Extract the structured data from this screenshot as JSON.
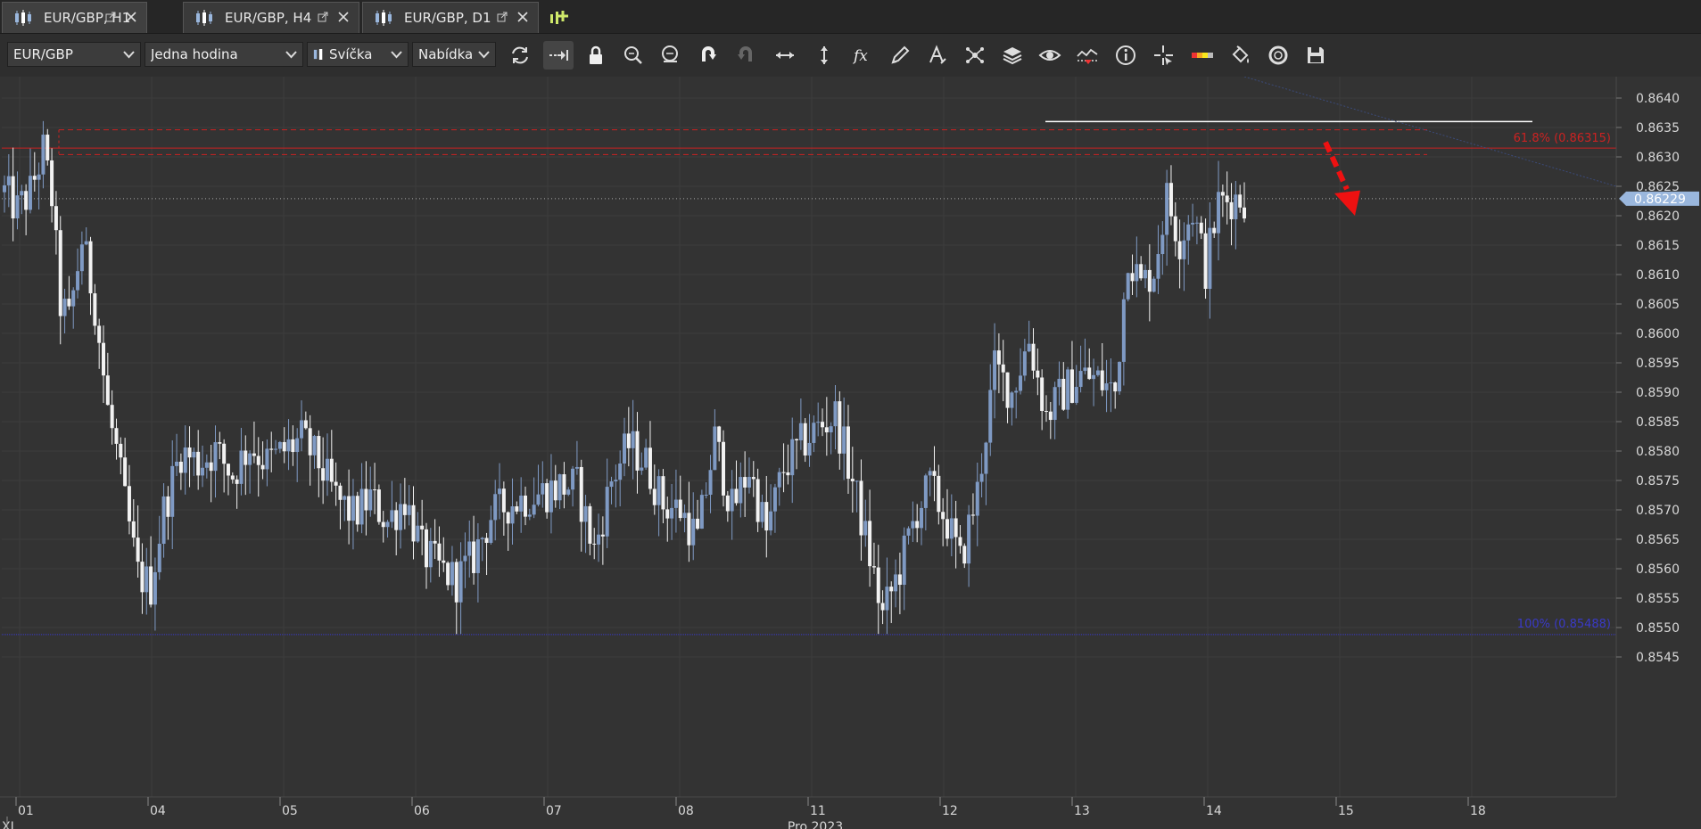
{
  "tabs": [
    {
      "label": "EUR/GBP, H1",
      "active": true
    },
    {
      "label": "EUR/GBP, H4",
      "active": false
    },
    {
      "label": "EUR/GBP, D1",
      "active": false
    }
  ],
  "toolbar": {
    "symbol": "EUR/GBP",
    "timeframe": "Jedna hodina",
    "chart_type": "Svíčka",
    "price_type": "Nabídka",
    "tools": [
      "refresh-icon",
      "auto-scroll-icon",
      "lock-icon",
      "zoom-in-icon",
      "zoom-out-icon",
      "undo-icon",
      "redo-icon",
      "horizontal-resize-icon",
      "vertical-resize-icon",
      "function-icon",
      "pencil-icon",
      "text-tool-icon",
      "objects-icon",
      "layers-icon",
      "eye-icon",
      "alerts-icon",
      "info-icon",
      "crosshair-icon",
      "color-scheme-icon",
      "paint-bucket-icon",
      "sync-icon",
      "save-icon"
    ]
  },
  "colors": {
    "background": "#333333",
    "grid": "#3d3d3d",
    "bull": "#7f9ac4",
    "bear": "#f2f2f2",
    "fib_upper": "#cc2222",
    "fib_lower": "#3a3ac8",
    "price_label": "#9ab7dd",
    "arrow": "#ee1111"
  },
  "chart_data": {
    "type": "candlestick",
    "symbol": "EUR/GBP",
    "timeframe": "H1",
    "ylim": [
      0.854,
      0.8643
    ],
    "y_ticks": [
      "0.8640",
      "0.8635",
      "0.8630",
      "0.8625",
      "0.8620",
      "0.8615",
      "0.8610",
      "0.8605",
      "0.8600",
      "0.8595",
      "0.8590",
      "0.8585",
      "0.8580",
      "0.8575",
      "0.8570",
      "0.8565",
      "0.8560",
      "0.8555",
      "0.8550",
      "0.8545"
    ],
    "x_ticks": [
      "01",
      "04",
      "05",
      "06",
      "07",
      "08",
      "11",
      "12",
      "13",
      "14",
      "15",
      "18"
    ],
    "x_month_labels": [
      "XI",
      "Pro 2023"
    ],
    "current_price": "0.86229",
    "fib_levels": [
      {
        "label": "61.8% (0.86315)",
        "value": 0.86315
      },
      {
        "label": "100% (0.85488)",
        "value": 0.85488
      }
    ],
    "anchors": [
      {
        "i": 0,
        "v": 0.8624
      },
      {
        "i": 3,
        "v": 0.8621
      },
      {
        "i": 6,
        "v": 0.8624
      },
      {
        "i": 9,
        "v": 0.8631
      },
      {
        "i": 11,
        "v": 0.8623
      },
      {
        "i": 13,
        "v": 0.8605
      },
      {
        "i": 15,
        "v": 0.8602
      },
      {
        "i": 18,
        "v": 0.8616
      },
      {
        "i": 21,
        "v": 0.8605
      },
      {
        "i": 24,
        "v": 0.8587
      },
      {
        "i": 26,
        "v": 0.858
      },
      {
        "i": 28,
        "v": 0.8571
      },
      {
        "i": 31,
        "v": 0.8559
      },
      {
        "i": 34,
        "v": 0.8557
      },
      {
        "i": 37,
        "v": 0.857
      },
      {
        "i": 41,
        "v": 0.858
      },
      {
        "i": 45,
        "v": 0.8578
      },
      {
        "i": 49,
        "v": 0.858
      },
      {
        "i": 53,
        "v": 0.8576
      },
      {
        "i": 57,
        "v": 0.8581
      },
      {
        "i": 61,
        "v": 0.8578
      },
      {
        "i": 65,
        "v": 0.858
      },
      {
        "i": 69,
        "v": 0.8582
      },
      {
        "i": 73,
        "v": 0.8578
      },
      {
        "i": 77,
        "v": 0.8572
      },
      {
        "i": 81,
        "v": 0.8569
      },
      {
        "i": 85,
        "v": 0.8572
      },
      {
        "i": 89,
        "v": 0.8568
      },
      {
        "i": 93,
        "v": 0.8572
      },
      {
        "i": 97,
        "v": 0.8563
      },
      {
        "i": 101,
        "v": 0.856
      },
      {
        "i": 105,
        "v": 0.8558
      },
      {
        "i": 109,
        "v": 0.8562
      },
      {
        "i": 113,
        "v": 0.8569
      },
      {
        "i": 117,
        "v": 0.8571
      },
      {
        "i": 121,
        "v": 0.8572
      },
      {
        "i": 125,
        "v": 0.8573
      },
      {
        "i": 129,
        "v": 0.8574
      },
      {
        "i": 133,
        "v": 0.8574
      },
      {
        "i": 137,
        "v": 0.8563
      },
      {
        "i": 141,
        "v": 0.8575
      },
      {
        "i": 145,
        "v": 0.8581
      },
      {
        "i": 149,
        "v": 0.8578
      },
      {
        "i": 153,
        "v": 0.8571
      },
      {
        "i": 157,
        "v": 0.857
      },
      {
        "i": 161,
        "v": 0.8565
      },
      {
        "i": 165,
        "v": 0.8582
      },
      {
        "i": 169,
        "v": 0.857
      },
      {
        "i": 173,
        "v": 0.8577
      },
      {
        "i": 177,
        "v": 0.8566
      },
      {
        "i": 181,
        "v": 0.8577
      },
      {
        "i": 185,
        "v": 0.8581
      },
      {
        "i": 189,
        "v": 0.8584
      },
      {
        "i": 193,
        "v": 0.8586
      },
      {
        "i": 197,
        "v": 0.8575
      },
      {
        "i": 201,
        "v": 0.8562
      },
      {
        "i": 204,
        "v": 0.8552
      },
      {
        "i": 208,
        "v": 0.856
      },
      {
        "i": 212,
        "v": 0.857
      },
      {
        "i": 215,
        "v": 0.8574
      },
      {
        "i": 219,
        "v": 0.8568
      },
      {
        "i": 222,
        "v": 0.8561
      },
      {
        "i": 226,
        "v": 0.8573
      },
      {
        "i": 230,
        "v": 0.8594
      },
      {
        "i": 234,
        "v": 0.859
      },
      {
        "i": 238,
        "v": 0.8599
      },
      {
        "i": 242,
        "v": 0.8586
      },
      {
        "i": 246,
        "v": 0.859
      },
      {
        "i": 250,
        "v": 0.8593
      },
      {
        "i": 254,
        "v": 0.8592
      },
      {
        "i": 258,
        "v": 0.859
      },
      {
        "i": 261,
        "v": 0.8614
      },
      {
        "i": 264,
        "v": 0.8608
      },
      {
        "i": 267,
        "v": 0.8611
      },
      {
        "i": 270,
        "v": 0.8623
      },
      {
        "i": 273,
        "v": 0.8616
      },
      {
        "i": 276,
        "v": 0.8621
      },
      {
        "i": 279,
        "v": 0.8611
      },
      {
        "i": 282,
        "v": 0.8622
      },
      {
        "i": 285,
        "v": 0.8623
      },
      {
        "i": 288,
        "v": 0.8623
      }
    ],
    "n_candles": 289
  }
}
